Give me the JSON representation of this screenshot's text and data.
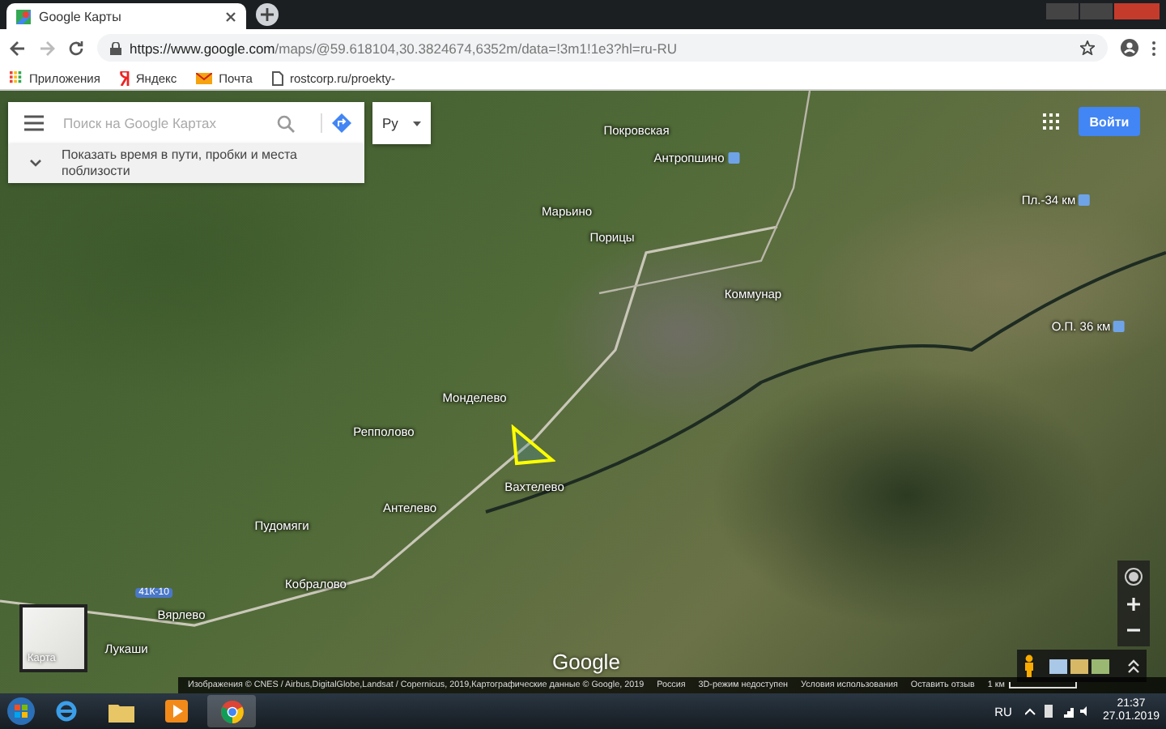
{
  "browser": {
    "tab_title": "Google Карты",
    "url_host": "https://www.google.com",
    "url_path": "/maps/@59.618104,30.3824674,6352m/data=!3m1!1e3?hl=ru-RU",
    "bookmarks": [
      {
        "label": "Приложения",
        "kind": "apps"
      },
      {
        "label": "Яндекс",
        "kind": "yandex"
      },
      {
        "label": "Почта",
        "kind": "mail"
      },
      {
        "label": "rostcorp.ru/proekty-",
        "kind": "page"
      }
    ]
  },
  "map": {
    "search": {
      "placeholder": "Поиск на Google Картах"
    },
    "hint": "Показать время в пути, пробки и места поблизости",
    "language": "Ру",
    "sign_in": "Войти",
    "labels": [
      {
        "text": "Покровская",
        "kind": "place"
      },
      {
        "text": "Антропшино",
        "kind": "station"
      },
      {
        "text": "Пл.-34 км",
        "kind": "station"
      },
      {
        "text": "Марьино",
        "kind": "place"
      },
      {
        "text": "Порицы",
        "kind": "place"
      },
      {
        "text": "Коммунар",
        "kind": "place"
      },
      {
        "text": "О.П. 36 км",
        "kind": "station"
      },
      {
        "text": "Монделево",
        "kind": "place"
      },
      {
        "text": "Репполово",
        "kind": "place"
      },
      {
        "text": "Вахтелево",
        "kind": "place"
      },
      {
        "text": "Антелево",
        "kind": "place"
      },
      {
        "text": "Пудомяги",
        "kind": "place"
      },
      {
        "text": "Кобралово",
        "kind": "place"
      },
      {
        "text": "41К-10",
        "kind": "road"
      },
      {
        "text": "Вярлево",
        "kind": "place"
      },
      {
        "text": "Лукаши",
        "kind": "place"
      }
    ],
    "map_type": "Карта",
    "logo": "Google",
    "footer": [
      "Изображения © CNES / Airbus,DigitalGlobe,Landsat / Copernicus, 2019,Картографические данные © Google, 2019",
      "Россия",
      "3D-режим недоступен",
      "Условия использования",
      "Оставить отзыв"
    ],
    "scale": "1 км"
  },
  "taskbar": {
    "language": "RU",
    "time": "21:37",
    "date": "27.01.2019"
  }
}
